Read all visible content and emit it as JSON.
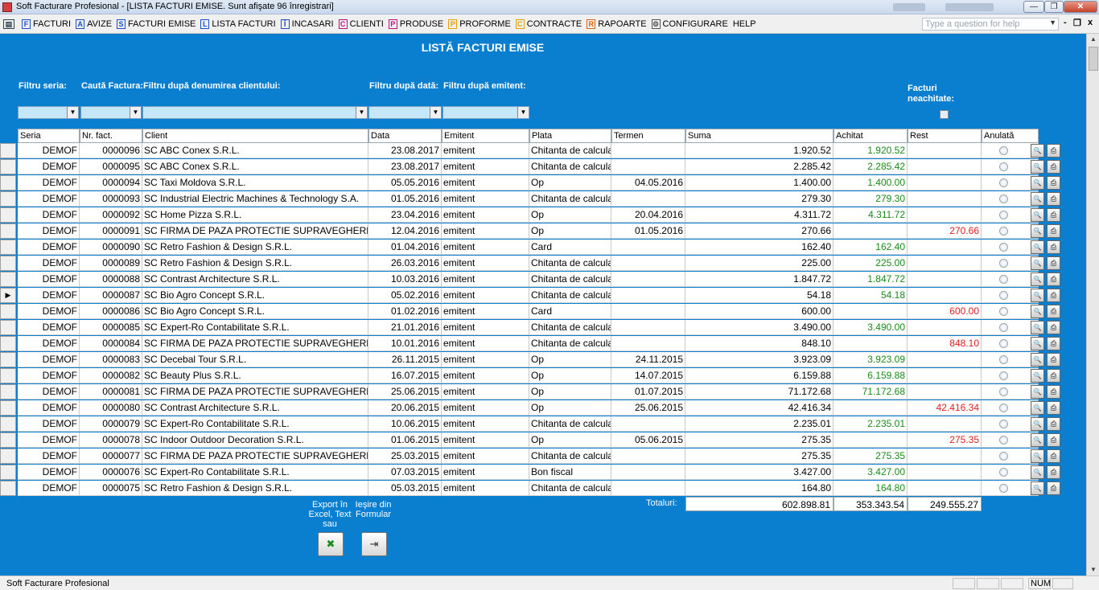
{
  "window": {
    "title": "Soft Facturare Profesional - [LISTA FACTURI EMISE. Sunt afişate 96 înregistrari]",
    "minimize": "—",
    "restore": "❐",
    "close": "✕"
  },
  "menu": {
    "items": [
      {
        "icon": "F",
        "label": "FACTURI",
        "color": "#1a4fd0"
      },
      {
        "icon": "A",
        "label": "AVIZE",
        "color": "#1a4fd0"
      },
      {
        "icon": "S",
        "label": "FACTURI EMISE",
        "color": "#1a4fd0"
      },
      {
        "icon": "L",
        "label": "LISTA FACTURI",
        "color": "#1a4fd0"
      },
      {
        "icon": "Î",
        "label": "INCASARI",
        "color": "#1a4fd0"
      },
      {
        "icon": "C",
        "label": "CLIENTI",
        "color": "#c01080"
      },
      {
        "icon": "P",
        "label": "PRODUSE",
        "color": "#c01080"
      },
      {
        "icon": "P",
        "label": "PROFORME",
        "color": "#e0a000"
      },
      {
        "icon": "C",
        "label": "CONTRACTE",
        "color": "#e0a000"
      },
      {
        "icon": "R",
        "label": "RAPOARTE",
        "color": "#e06000"
      },
      {
        "icon": "⚙",
        "label": "CONFIGURARE",
        "color": "#555555"
      },
      {
        "icon": "",
        "label": "HELP",
        "color": "#000000"
      }
    ],
    "help_placeholder": "Type a question for help",
    "mdi_min": "-",
    "mdi_restore": "❐",
    "mdi_close": "x"
  },
  "form": {
    "title": "LISTĂ FACTURI EMISE",
    "filters": {
      "seria": "Filtru seria:",
      "cauta": "Caută Factura:",
      "client": "Filtru după denumirea clientului:",
      "data": "Filtru după dată:",
      "emitent": "Filtru după emitent:",
      "neachitate": "Facturi neachitate:"
    },
    "columns": [
      "Seria",
      "Nr. fact.",
      "Client",
      "Data",
      "Emitent",
      "Plata",
      "Termen",
      "Suma",
      "Achitat",
      "Rest",
      "Anulată"
    ],
    "rows": [
      {
        "seria": "DEMOF",
        "nr": "0000096",
        "client": "SC ABC Conex S.R.L.",
        "data": "23.08.2017",
        "emitent": "emitent",
        "plata": "Chitanta de calcula",
        "termen": "",
        "suma": "1.920.52",
        "achitat": "1.920.52",
        "rest": ""
      },
      {
        "seria": "DEMOF",
        "nr": "0000095",
        "client": "SC ABC Conex S.R.L.",
        "data": "23.08.2017",
        "emitent": "emitent",
        "plata": "Chitanta de calcula",
        "termen": "",
        "suma": "2.285.42",
        "achitat": "2.285.42",
        "rest": ""
      },
      {
        "seria": "DEMOF",
        "nr": "0000094",
        "client": "SC Taxi Moldova S.R.L.",
        "data": "05.05.2016",
        "emitent": "emitent",
        "plata": "Op",
        "termen": "04.05.2016",
        "suma": "1.400.00",
        "achitat": "1.400.00",
        "rest": ""
      },
      {
        "seria": "DEMOF",
        "nr": "0000093",
        "client": "SC Industrial Electric Machines & Technology S.A.",
        "data": "01.05.2016",
        "emitent": "emitent",
        "plata": "Chitanta de calcula",
        "termen": "",
        "suma": "279.30",
        "achitat": "279.30",
        "rest": ""
      },
      {
        "seria": "DEMOF",
        "nr": "0000092",
        "client": "SC Home Pizza S.R.L.",
        "data": "23.04.2016",
        "emitent": "emitent",
        "plata": "Op",
        "termen": "20.04.2016",
        "suma": "4.311.72",
        "achitat": "4.311.72",
        "rest": ""
      },
      {
        "seria": "DEMOF",
        "nr": "0000091",
        "client": "SC FIRMA DE PAZA PROTECTIE SUPRAVEGHERE",
        "data": "12.04.2016",
        "emitent": "emitent",
        "plata": "Op",
        "termen": "01.05.2016",
        "suma": "270.66",
        "achitat": "",
        "rest": "270.66"
      },
      {
        "seria": "DEMOF",
        "nr": "0000090",
        "client": "SC Retro Fashion & Design S.R.L.",
        "data": "01.04.2016",
        "emitent": "emitent",
        "plata": "Card",
        "termen": "",
        "suma": "162.40",
        "achitat": "162.40",
        "rest": ""
      },
      {
        "seria": "DEMOF",
        "nr": "0000089",
        "client": "SC Retro Fashion & Design S.R.L.",
        "data": "26.03.2016",
        "emitent": "emitent",
        "plata": "Chitanta de calcula",
        "termen": "",
        "suma": "225.00",
        "achitat": "225.00",
        "rest": ""
      },
      {
        "seria": "DEMOF",
        "nr": "0000088",
        "client": "SC Contrast Architecture S.R.L.",
        "data": "10.03.2016",
        "emitent": "emitent",
        "plata": "Chitanta de calcula",
        "termen": "",
        "suma": "1.847.72",
        "achitat": "1.847.72",
        "rest": ""
      },
      {
        "seria": "DEMOF",
        "nr": "0000087",
        "client": "SC Bio Agro Concept S.R.L.",
        "data": "05.02.2016",
        "emitent": "emitent",
        "plata": "Chitanta de calcula",
        "termen": "",
        "suma": "54.18",
        "achitat": "54.18",
        "rest": ""
      },
      {
        "seria": "DEMOF",
        "nr": "0000086",
        "client": "SC Bio Agro Concept S.R.L.",
        "data": "01.02.2016",
        "emitent": "emitent",
        "plata": "Card",
        "termen": "",
        "suma": "600.00",
        "achitat": "",
        "rest": "600.00"
      },
      {
        "seria": "DEMOF",
        "nr": "0000085",
        "client": "SC Expert-Ro Contabilitate S.R.L.",
        "data": "21.01.2016",
        "emitent": "emitent",
        "plata": "Chitanta de calcula",
        "termen": "",
        "suma": "3.490.00",
        "achitat": "3.490.00",
        "rest": ""
      },
      {
        "seria": "DEMOF",
        "nr": "0000084",
        "client": "SC FIRMA DE PAZA PROTECTIE SUPRAVEGHERE",
        "data": "10.01.2016",
        "emitent": "emitent",
        "plata": "Chitanta de calcula",
        "termen": "",
        "suma": "848.10",
        "achitat": "",
        "rest": "848.10"
      },
      {
        "seria": "DEMOF",
        "nr": "0000083",
        "client": "SC Decebal Tour S.R.L.",
        "data": "26.11.2015",
        "emitent": "emitent",
        "plata": "Op",
        "termen": "24.11.2015",
        "suma": "3.923.09",
        "achitat": "3.923.09",
        "rest": ""
      },
      {
        "seria": "DEMOF",
        "nr": "0000082",
        "client": "SC Beauty Plus S.R.L.",
        "data": "16.07.2015",
        "emitent": "emitent",
        "plata": "Op",
        "termen": "14.07.2015",
        "suma": "6.159.88",
        "achitat": "6.159.88",
        "rest": ""
      },
      {
        "seria": "DEMOF",
        "nr": "0000081",
        "client": "SC FIRMA DE PAZA PROTECTIE SUPRAVEGHERE",
        "data": "25.06.2015",
        "emitent": "emitent",
        "plata": "Op",
        "termen": "01.07.2015",
        "suma": "71.172.68",
        "achitat": "71.172.68",
        "rest": ""
      },
      {
        "seria": "DEMOF",
        "nr": "0000080",
        "client": "SC Contrast Architecture S.R.L.",
        "data": "20.06.2015",
        "emitent": "emitent",
        "plata": "Op",
        "termen": "25.06.2015",
        "suma": "42.416.34",
        "achitat": "",
        "rest": "42.416.34"
      },
      {
        "seria": "DEMOF",
        "nr": "0000079",
        "client": "SC Expert-Ro Contabilitate S.R.L.",
        "data": "10.06.2015",
        "emitent": "emitent",
        "plata": "Chitanta de calcula",
        "termen": "",
        "suma": "2.235.01",
        "achitat": "2.235.01",
        "rest": ""
      },
      {
        "seria": "DEMOF",
        "nr": "0000078",
        "client": "SC Indoor Outdoor Decoration S.R.L.",
        "data": "01.06.2015",
        "emitent": "emitent",
        "plata": "Op",
        "termen": "05.06.2015",
        "suma": "275.35",
        "achitat": "",
        "rest": "275.35"
      },
      {
        "seria": "DEMOF",
        "nr": "0000077",
        "client": "SC FIRMA DE PAZA PROTECTIE SUPRAVEGHERE",
        "data": "25.03.2015",
        "emitent": "emitent",
        "plata": "Chitanta de calcula",
        "termen": "",
        "suma": "275.35",
        "achitat": "275.35",
        "rest": ""
      },
      {
        "seria": "DEMOF",
        "nr": "0000076",
        "client": "SC Expert-Ro Contabilitate S.R.L.",
        "data": "07.03.2015",
        "emitent": "emitent",
        "plata": "Bon fiscal",
        "termen": "",
        "suma": "3.427.00",
        "achitat": "3.427.00",
        "rest": ""
      },
      {
        "seria": "DEMOF",
        "nr": "0000075",
        "client": "SC Retro Fashion & Design S.R.L.",
        "data": "05.03.2015",
        "emitent": "emitent",
        "plata": "Chitanta de calcula",
        "termen": "",
        "suma": "164.80",
        "achitat": "164.80",
        "rest": ""
      }
    ],
    "current_row_marker": "▶",
    "totals": {
      "label": "Totaluri:",
      "suma": "602.898.81",
      "achitat": "353.343.54",
      "rest": "249.555.27"
    },
    "export_label": "Export în Excel, Text sau",
    "exit_label": "Ieşire din Formular"
  },
  "status": {
    "text": "Soft Facturare Profesional",
    "num": "NUM"
  },
  "colors": {
    "form_bg": "#0a7fd0",
    "paid": "#1a8a1a",
    "unpaid": "#e02020"
  }
}
